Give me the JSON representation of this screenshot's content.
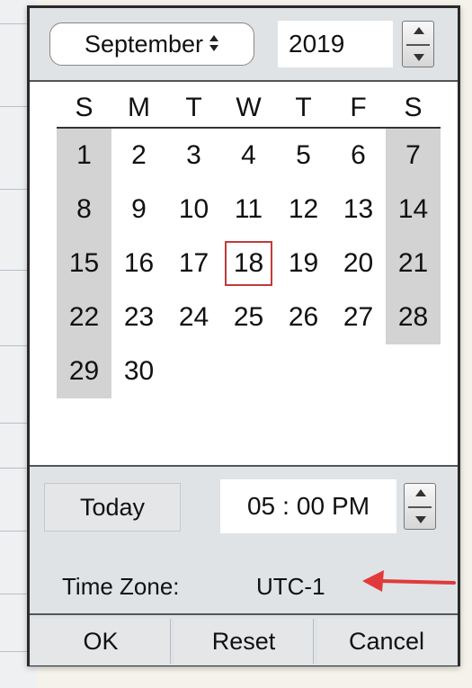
{
  "header": {
    "month": "September",
    "year": "2019",
    "month_icon": "updown-icon"
  },
  "calendar": {
    "weekdays": [
      "S",
      "M",
      "T",
      "W",
      "T",
      "F",
      "S"
    ],
    "weeks": [
      [
        "1",
        "2",
        "3",
        "4",
        "5",
        "6",
        "7"
      ],
      [
        "8",
        "9",
        "10",
        "11",
        "12",
        "13",
        "14"
      ],
      [
        "15",
        "16",
        "17",
        "18",
        "19",
        "20",
        "21"
      ],
      [
        "22",
        "23",
        "24",
        "25",
        "26",
        "27",
        "28"
      ],
      [
        "29",
        "30",
        "",
        "",
        "",
        "",
        ""
      ]
    ],
    "selected_day": "18",
    "selected_color": "#c23b3b",
    "weekend_color": "#d3d3d3"
  },
  "footer": {
    "today_label": "Today",
    "time_hour": "05",
    "time_sep": ":",
    "time_minute": "00",
    "time_ampm": "PM",
    "tz_label": "Time Zone:",
    "tz_value": "UTC-1",
    "arrow_color": "#e03a3a"
  },
  "actions": {
    "ok_label": "OK",
    "reset_label": "Reset",
    "cancel_label": "Cancel"
  }
}
